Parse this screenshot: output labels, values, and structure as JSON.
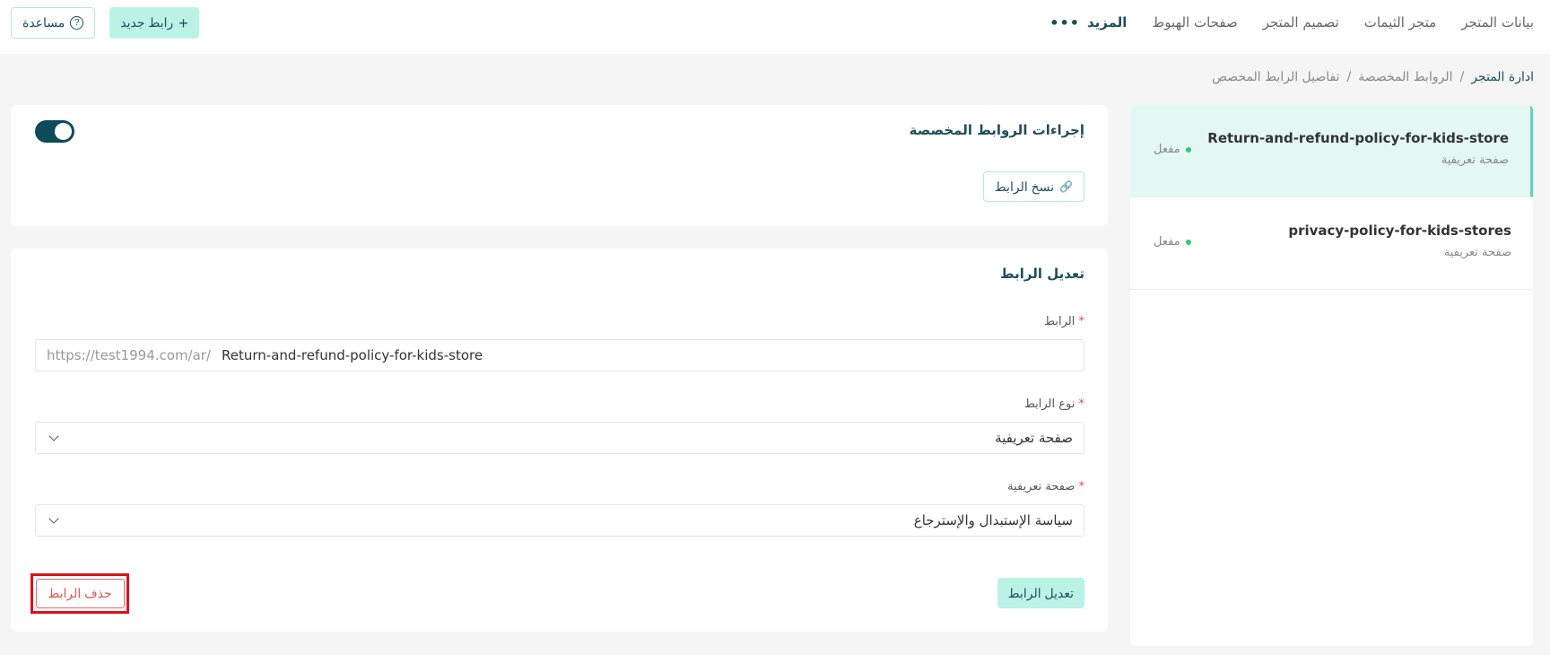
{
  "topbar": {
    "nav": [
      "بيانات المتجر",
      "متجر الثيمات",
      "تصميم المتجر",
      "صفحات الهبوط"
    ],
    "more_label": "المزيد",
    "more_dots": "•••",
    "new_link_label": "رابط جديد",
    "help_label": "مساعدة",
    "help_glyph": "?"
  },
  "breadcrumb": {
    "root": "ادارة المتجر",
    "sep": "/",
    "level2": "الروابط المخصصة",
    "level3": "تفاصيل الرابط المخصص"
  },
  "list": [
    {
      "title": "Return-and-refund-policy-for-kids-store",
      "subtitle": "صفحة تعريفية",
      "status": "مفعل",
      "active": true
    },
    {
      "title": "privacy-policy-for-kids-stores",
      "subtitle": "صفحة تعريفية",
      "status": "مفعل",
      "active": false
    }
  ],
  "actions_card": {
    "title": "إجراءات الروابط المخصصة",
    "copy_label": "نسخ الرابط",
    "toggle_on": true
  },
  "edit_card": {
    "title": "تعديل الرابط",
    "link_label": "الرابط",
    "required_mark": "*",
    "url_prefix": "https://test1994.com/ar/",
    "url_value": "Return-and-refund-policy-for-kids-store",
    "type_label": "نوع الرابط",
    "type_value": "صفحة تعريفية",
    "page_label": "صفحة تعريفية",
    "page_value": "سياسة الإستبدال والإسترجاع",
    "edit_button": "تعديل الرابط",
    "delete_button": "حذف الرابط"
  },
  "colors": {
    "accent": "#baf3e6",
    "dark": "#1f4e5c",
    "danger": "#d6141c",
    "status_active": "#2ecc71"
  }
}
